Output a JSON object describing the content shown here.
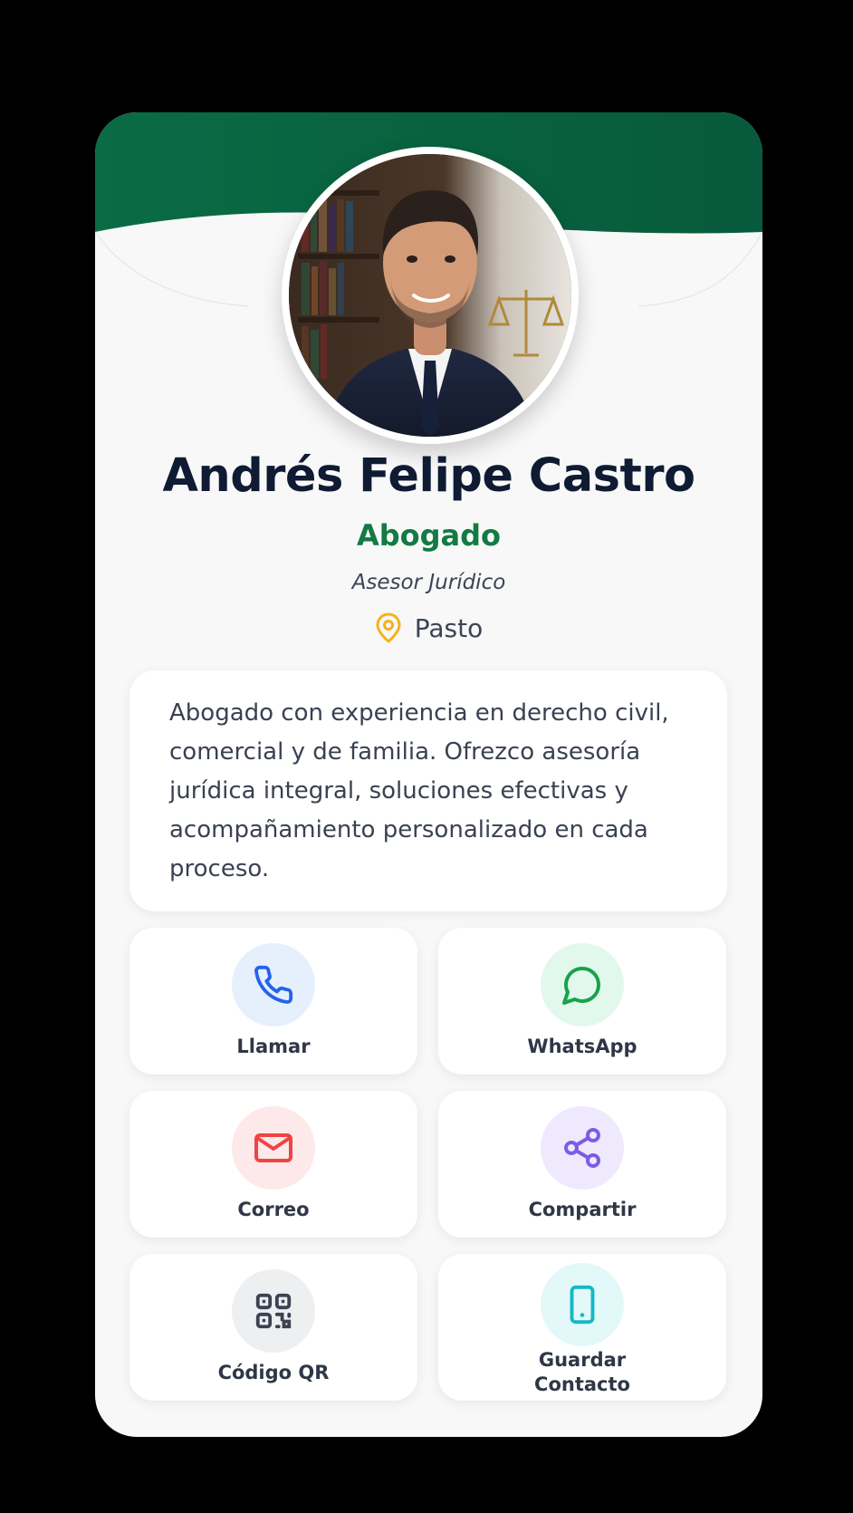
{
  "profile": {
    "name": "Andrés Felipe Castro",
    "title": "Abogado",
    "subtitle": "Asesor Jurídico",
    "location": "Pasto",
    "bio": "Abogado con experiencia en derecho civil, comercial y de familia. Ofrezco asesoría jurídica integral, soluciones efectivas y acompañamiento personalizado en cada proceso."
  },
  "actions": {
    "call": {
      "label": "Llamar",
      "icon": "phone-icon"
    },
    "whatsapp": {
      "label": "WhatsApp",
      "icon": "whatsapp-icon"
    },
    "email": {
      "label": "Correo",
      "icon": "mail-icon"
    },
    "share": {
      "label": "Compartir",
      "icon": "share-icon"
    },
    "qr": {
      "label": "Código QR",
      "icon": "qr-code-icon"
    },
    "save": {
      "label": "Guardar Contacto",
      "icon": "smartphone-icon"
    }
  },
  "colors": {
    "brand_green": "#0a6a44",
    "title_green": "#137a43",
    "name_navy": "#0f1b33",
    "pin_yellow": "#f5b21a",
    "call_blue": "#2563eb",
    "whatsapp_green": "#16a34a",
    "mail_red": "#ef4444",
    "share_purple": "#7c5ce6",
    "qr_dark": "#3b4252",
    "save_cyan": "#14b8c4"
  }
}
